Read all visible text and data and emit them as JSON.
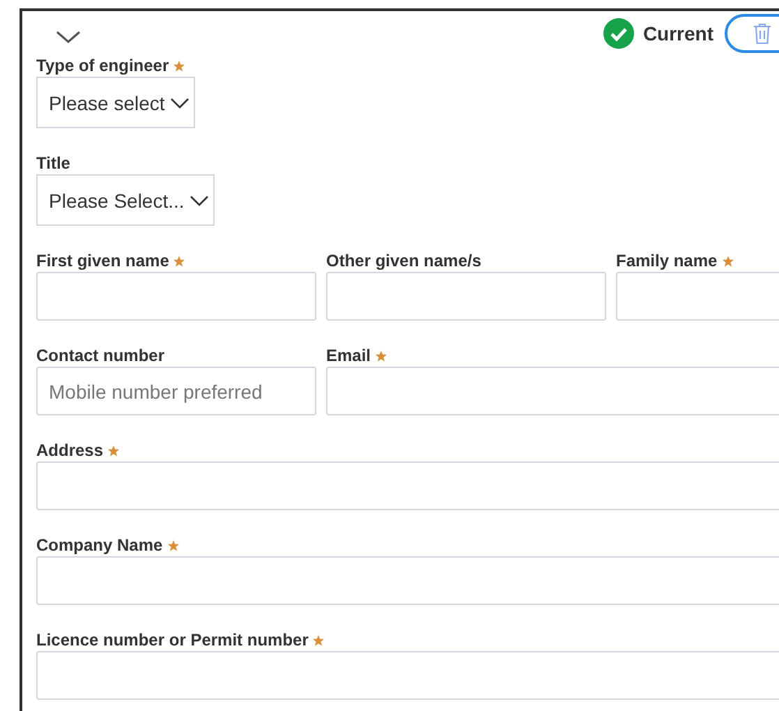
{
  "header": {
    "status": "Current"
  },
  "rows": [
    {
      "fields": [
        {
          "label": "Type of engineer",
          "required": true,
          "kind": "select",
          "value": "Please select"
        }
      ]
    },
    {
      "fields": [
        {
          "label": "Title",
          "required": false,
          "kind": "select",
          "value": "Please Select..."
        }
      ]
    },
    {
      "fields": [
        {
          "label": "First given name",
          "required": true,
          "kind": "text"
        },
        {
          "label": "Other given name/s",
          "required": false,
          "kind": "text"
        },
        {
          "label": "Family name",
          "required": true,
          "kind": "text"
        }
      ]
    },
    {
      "fields": [
        {
          "label": "Contact number",
          "required": false,
          "kind": "text",
          "placeholder": "Mobile number preferred"
        },
        {
          "label": "Email",
          "required": true,
          "kind": "text"
        }
      ]
    },
    {
      "fields": [
        {
          "label": "Address",
          "required": true,
          "kind": "text"
        }
      ]
    },
    {
      "fields": [
        {
          "label": "Company Name",
          "required": true,
          "kind": "text"
        }
      ]
    },
    {
      "fields": [
        {
          "label": "Licence number or Permit number",
          "required": true,
          "kind": "text"
        }
      ]
    }
  ]
}
